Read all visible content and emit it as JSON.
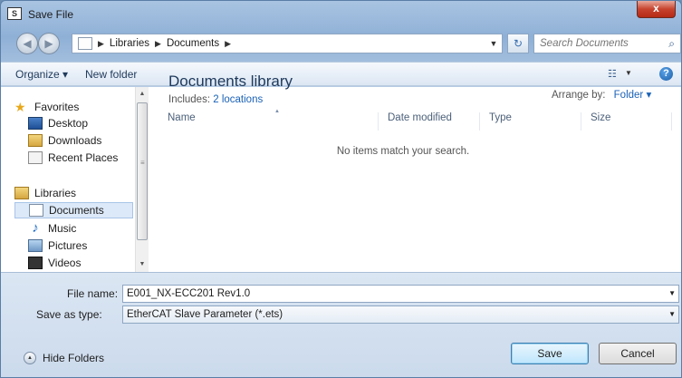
{
  "window": {
    "title": "Save File",
    "close_glyph": "x"
  },
  "address": {
    "crumbs": [
      "Libraries",
      "Documents"
    ],
    "search_placeholder": "Search Documents"
  },
  "toolbar": {
    "organize": "Organize ▾",
    "new_folder": "New folder"
  },
  "navpane": {
    "favorites": "Favorites",
    "desktop": "Desktop",
    "downloads": "Downloads",
    "recent_places": "Recent Places",
    "libraries": "Libraries",
    "documents": "Documents",
    "music": "Music",
    "pictures": "Pictures",
    "videos": "Videos"
  },
  "content": {
    "title": "Documents library",
    "includes_prefix": "Includes:",
    "includes_link": "2 locations",
    "arrange_label": "Arrange by:",
    "arrange_value": "Folder ▾",
    "columns": {
      "name": "Name",
      "date": "Date modified",
      "type": "Type",
      "size": "Size"
    },
    "empty_message": "No items match your search."
  },
  "fields": {
    "file_name_label": "File name:",
    "file_name_value": "E001_NX-ECC201 Rev1.0",
    "save_type_label": "Save as type:",
    "save_type_value": "EtherCAT Slave Parameter (*.ets)"
  },
  "footer": {
    "hide_folders": "Hide Folders",
    "save": "Save",
    "cancel": "Cancel"
  },
  "colors": {
    "accent": "#1a62b7",
    "title_blue": "#1e395b",
    "selection": "#dce9f8",
    "close_red": "#c7432e"
  }
}
